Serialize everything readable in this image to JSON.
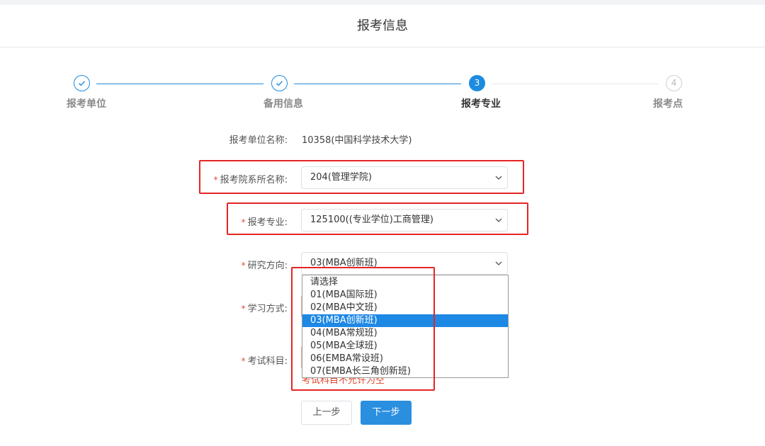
{
  "header": {
    "title": "报考信息"
  },
  "steps": [
    {
      "label": "报考单位",
      "state": "done",
      "icon": "check-icon"
    },
    {
      "label": "备用信息",
      "state": "done",
      "icon": "check-icon"
    },
    {
      "label": "报考专业",
      "state": "active",
      "number": "3"
    },
    {
      "label": "报考点",
      "state": "todo",
      "number": "4"
    }
  ],
  "form": {
    "unit": {
      "label": "报考单位名称:",
      "value": "10358(中国科学技术大学)"
    },
    "department": {
      "required": "*",
      "label": "报考院系所名称:",
      "value": "204(管理学院)"
    },
    "major": {
      "required": "*",
      "label": "报考专业:",
      "value": "125100((专业学位)工商管理)"
    },
    "direction": {
      "required": "*",
      "label": "研究方向:",
      "value": "03(MBA创新班)",
      "options": [
        "请选择",
        "01(MBA国际班)",
        "02(MBA中文班)",
        "03(MBA创新班)",
        "04(MBA常规班)",
        "05(MBA全球班)",
        "06(EMBA常设班)",
        "07(EMBA长三角创新班)"
      ],
      "selected_index": 3
    },
    "study_mode": {
      "required": "*",
      "label": "学习方式:"
    },
    "exam_subjects": {
      "required": "*",
      "label": "考试科目:",
      "warning": "考试科目不允许为空"
    }
  },
  "buttons": {
    "prev": "上一步",
    "next": "下一步"
  },
  "colors": {
    "primary": "#1d8ce0",
    "highlight_box": "#e62424",
    "required": "#e74c3c"
  }
}
